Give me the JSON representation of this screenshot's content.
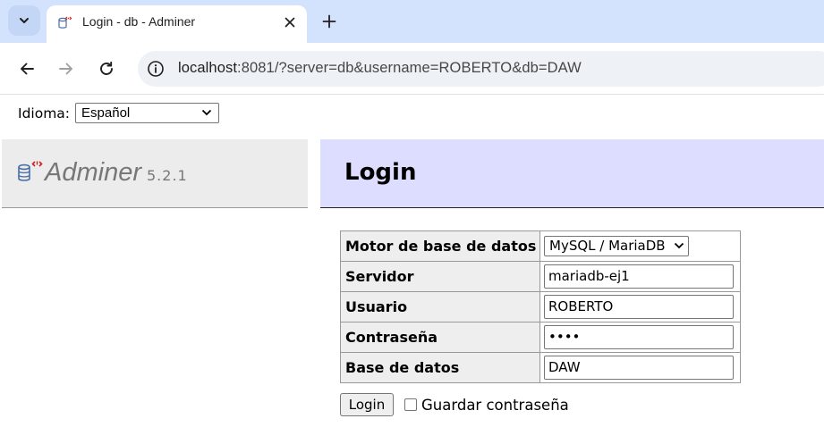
{
  "browser": {
    "tab": {
      "title": "Login - db - Adminer"
    },
    "address_bar": {
      "url_host": "localhost",
      "url_rest": ":8081/?server=db&username=ROBERTO&db=DAW"
    }
  },
  "language": {
    "label": "Idioma:",
    "selected": "Español"
  },
  "menu": {
    "brand_name": "Adminer",
    "version": "5.2.1"
  },
  "content": {
    "title": "Login",
    "form": {
      "engine_label": "Motor de base de datos",
      "engine_value": "MySQL / MariaDB",
      "server_label": "Servidor",
      "server_value": "mariadb-ej1",
      "user_label": "Usuario",
      "user_value": "ROBERTO",
      "password_label": "Contraseña",
      "password_value": "••••",
      "database_label": "Base de datos",
      "database_value": "DAW"
    },
    "login_button": "Login",
    "remember_label": "Guardar contraseña"
  },
  "icons": {
    "tab_list": "chevron-down-icon",
    "favicon": "adminer-favicon-icon",
    "close": "close-icon",
    "new_tab": "plus-icon",
    "back": "arrow-left-icon",
    "forward": "arrow-right-icon",
    "reload": "reload-icon",
    "site_info": "site-info-icon",
    "logo": "database-icon"
  },
  "colors": {
    "tabbar": "#d3e3fd",
    "content_header": "#ddddff",
    "menu_panel": "#ececec",
    "logo_accent": "#cc2222"
  }
}
